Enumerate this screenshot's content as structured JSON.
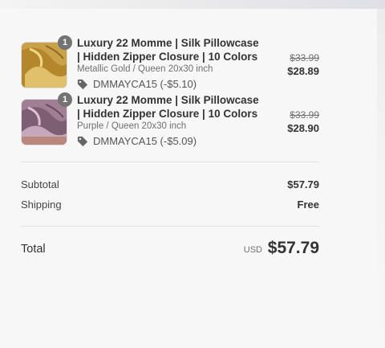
{
  "items": [
    {
      "quantity": "1",
      "title": "Luxury 22 Momme | Silk Pillowcase | Hidden Zipper Closure | 10 Colors",
      "variant": "Metallic Gold / Queen 20x30 inch",
      "discount": "DMMAYCA15 (-$5.10)",
      "original_price": "$33.99",
      "price": "$28.89",
      "thumb_color": "#c99a3b"
    },
    {
      "quantity": "1",
      "title": "Luxury 22 Momme | Silk Pillowcase | Hidden Zipper Closure | 10 Colors",
      "variant": "Purple / Queen 20x30 inch",
      "discount": "DMMAYCA15 (-$5.09)",
      "original_price": "$33.99",
      "price": "$28.90",
      "thumb_color": "#9a7890"
    }
  ],
  "summary": {
    "subtotal_label": "Subtotal",
    "subtotal_value": "$57.79",
    "shipping_label": "Shipping",
    "shipping_value": "Free",
    "total_label": "Total",
    "currency": "USD",
    "total_value": "$57.79"
  },
  "icons": {
    "discount": "tag-icon"
  }
}
